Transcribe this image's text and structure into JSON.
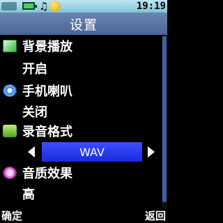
{
  "status_bar": {
    "time": "19:19"
  },
  "header": {
    "title": "设置"
  },
  "settings": [
    {
      "label": "背景播放",
      "icon": "background-play-icon",
      "value": "开启"
    },
    {
      "label": "手机喇叭",
      "icon": "speaker-icon",
      "value": "关闭"
    },
    {
      "label": "录音格式",
      "icon": "record-format-icon",
      "value": "WAV"
    },
    {
      "label": "音质效果",
      "icon": "quality-icon",
      "value": "高"
    }
  ],
  "softkeys": {
    "left": "确定",
    "right": "返回"
  }
}
